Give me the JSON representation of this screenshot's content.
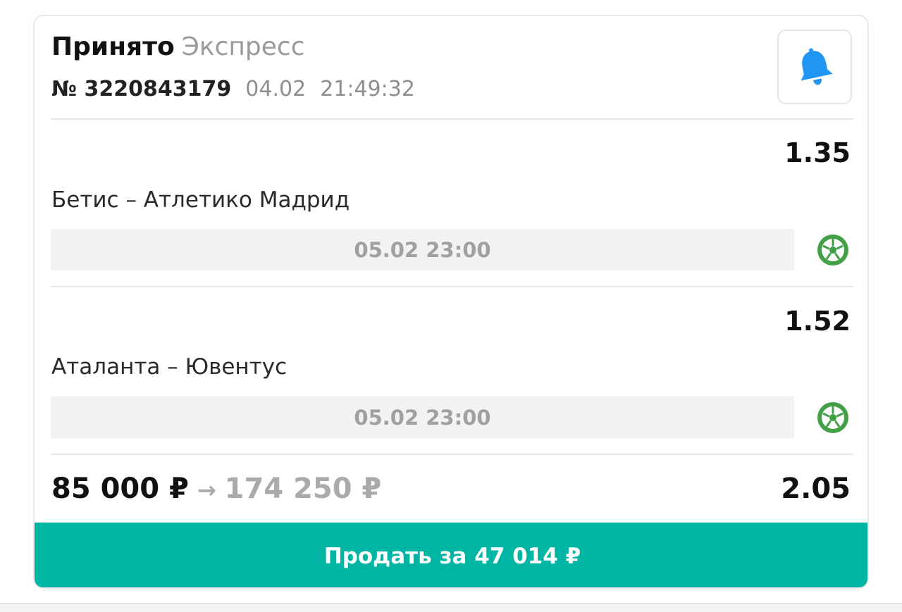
{
  "header": {
    "status": "Принято",
    "bet_type": "Экспресс",
    "number": "№ 3220843179",
    "date": "04.02",
    "time": "21:49:32"
  },
  "icons": {
    "notify": "bell-icon",
    "sport": "soccer-ball-icon"
  },
  "events": [
    {
      "odds": "1.35",
      "name": "Бетис – Атлетико Мадрид",
      "datetime": "05.02 23:00"
    },
    {
      "odds": "1.52",
      "name": "Аталанта – Ювентус",
      "datetime": "05.02 23:00"
    }
  ],
  "summary": {
    "stake": "85 000 ₽",
    "arrow": "→",
    "payout": "174 250 ₽",
    "total_odds": "2.05"
  },
  "sell_button": {
    "label": "Продать за 47 014 ₽"
  },
  "colors": {
    "accent": "#00b5a4",
    "bell": "#2196f3",
    "sport_icon": "#43a047"
  }
}
